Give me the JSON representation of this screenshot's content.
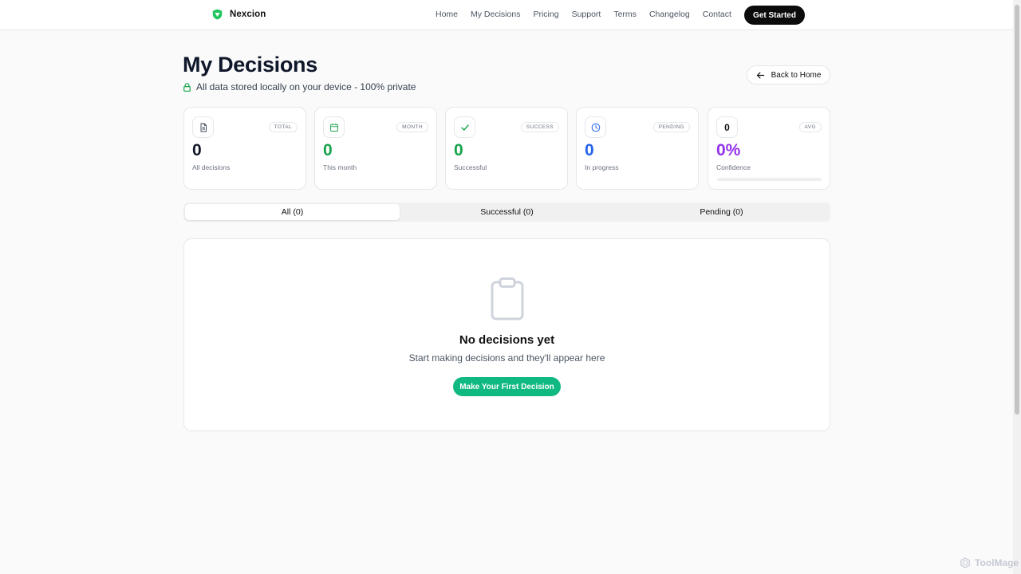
{
  "header": {
    "brand": "Nexcion",
    "nav": [
      "Home",
      "My Decisions",
      "Pricing",
      "Support",
      "Terms",
      "Changelog",
      "Contact"
    ],
    "cta": "Get Started"
  },
  "page": {
    "title": "My Decisions",
    "privacy": "All data stored locally on your device - 100% private",
    "back_label": "Back to Home"
  },
  "stats": [
    {
      "icon": "document-icon",
      "badge": "TOTAL",
      "value": "0",
      "label": "All decisions",
      "color": "#111827"
    },
    {
      "icon": "calendar-icon",
      "badge": "MONTH",
      "value": "0",
      "label": "This month",
      "color": "#16a34a"
    },
    {
      "icon": "check-icon",
      "badge": "SUCCESS",
      "value": "0",
      "label": "Successful",
      "color": "#16a34a"
    },
    {
      "icon": "clock-icon",
      "badge": "PENDING",
      "value": "0",
      "label": "In progress",
      "color": "#2563eb"
    },
    {
      "icon_text": "0",
      "badge": "AVG",
      "value": "0%",
      "label": "Confidence",
      "color": "#9333ea",
      "progress": 0
    }
  ],
  "tabs": [
    {
      "label": "All (0)",
      "active": true
    },
    {
      "label": "Successful (0)",
      "active": false
    },
    {
      "label": "Pending (0)",
      "active": false
    }
  ],
  "empty_state": {
    "icon": "clipboard-icon",
    "title": "No decisions yet",
    "subtitle": "Start making decisions and they'll appear here",
    "button": "Make Your First Decision"
  },
  "watermark": "ToolMage",
  "colors": {
    "accent": "#10b981",
    "brand_green": "#22c55e",
    "confidence": "#9333ea"
  }
}
